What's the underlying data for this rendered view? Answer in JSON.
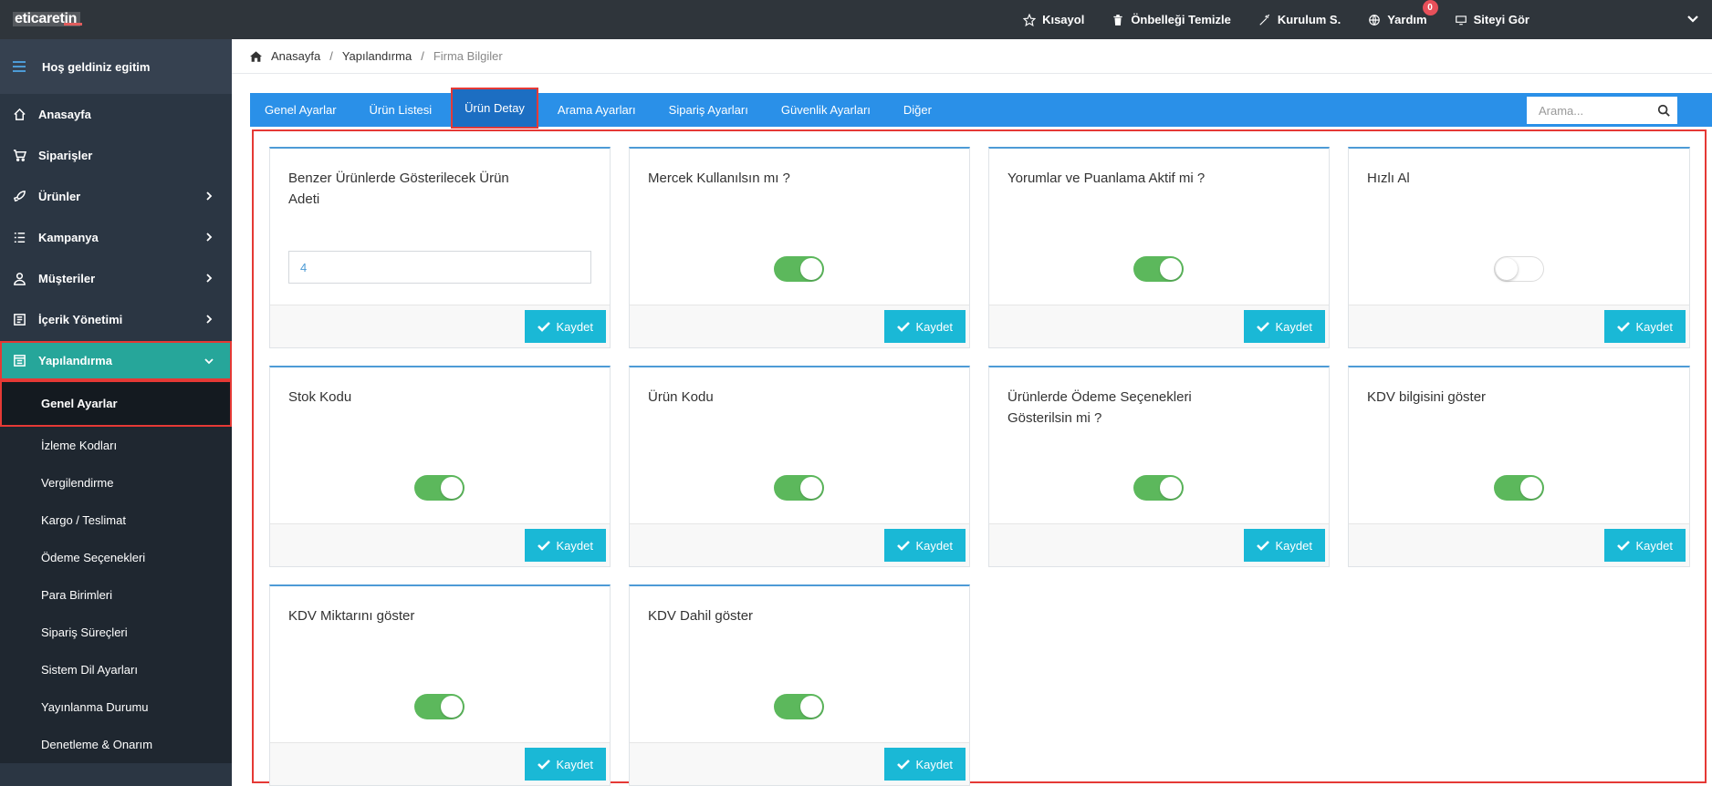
{
  "brand": {
    "logo": "eticaretin"
  },
  "topbar": {
    "items": [
      {
        "label": "Kısayol",
        "icon": "star-icon"
      },
      {
        "label": "Önbelleği Temizle",
        "icon": "trash-icon"
      },
      {
        "label": "Kurulum S.",
        "icon": "wand-icon"
      },
      {
        "label": "Yardım",
        "icon": "globe-icon",
        "badge": "0"
      },
      {
        "label": "Siteyi Gör",
        "icon": "monitor-icon"
      }
    ]
  },
  "sidebar": {
    "welcome": "Hoş geldiniz egitim",
    "items": [
      {
        "label": "Anasayfa",
        "icon": "home-icon"
      },
      {
        "label": "Siparişler",
        "icon": "cart-icon"
      },
      {
        "label": "Ürünler",
        "icon": "rocket-icon",
        "has_children": true
      },
      {
        "label": "Kampanya",
        "icon": "list-icon",
        "has_children": true
      },
      {
        "label": "Müşteriler",
        "icon": "user-icon",
        "has_children": true
      },
      {
        "label": "İçerik Yönetimi",
        "icon": "content-icon",
        "has_children": true
      },
      {
        "label": "Yapılandırma",
        "icon": "config-icon",
        "has_children": true,
        "active": true
      }
    ],
    "submenu": [
      "Genel Ayarlar",
      "İzleme Kodları",
      "Vergilendirme",
      "Kargo / Teslimat",
      "Ödeme Seçenekleri",
      "Para Birimleri",
      "Sipariş Süreçleri",
      "Sistem Dil Ayarları",
      "Yayınlanma Durumu",
      "Denetleme & Onarım"
    ]
  },
  "breadcrumb": {
    "home": "Anasayfa",
    "section": "Yapılandırma",
    "current": "Firma Bilgiler"
  },
  "tabs": [
    "Genel Ayarlar",
    "Ürün Listesi",
    "Ürün Detay",
    "Arama Ayarları",
    "Sipariş Ayarları",
    "Güvenlik Ayarları",
    "Diğer"
  ],
  "selected_tab": "Ürün Detay",
  "search": {
    "placeholder": "Arama...",
    "value": ""
  },
  "save_label": "Kaydet",
  "cards": [
    {
      "title": "Benzer Ürünlerde Gösterilecek Ürün Adeti",
      "type": "input",
      "value": "4"
    },
    {
      "title": "Mercek Kullanılsın mı ?",
      "type": "toggle",
      "on": true
    },
    {
      "title": "Yorumlar ve Puanlama Aktif mi ?",
      "type": "toggle",
      "on": true
    },
    {
      "title": "Hızlı Al",
      "type": "toggle",
      "on": false
    },
    {
      "title": "Stok Kodu",
      "type": "toggle",
      "on": true
    },
    {
      "title": "Ürün Kodu",
      "type": "toggle",
      "on": true
    },
    {
      "title": "Ürünlerde Ödeme Seçenekleri Gösterilsin mi ?",
      "type": "toggle",
      "on": true
    },
    {
      "title": "KDV bilgisini göster",
      "type": "toggle",
      "on": true
    },
    {
      "title": "KDV Miktarını göster",
      "type": "toggle",
      "on": true
    },
    {
      "title": "KDV Dahil göster",
      "type": "toggle",
      "on": true
    }
  ],
  "colors": {
    "topbar": "#2f353b",
    "sidebar": "#2b3643",
    "active": "#26a69a",
    "tabbar": "#2a90e8",
    "button": "#1ab8d6",
    "toggle_on": "#5cb85c",
    "highlight": "#e53935"
  }
}
